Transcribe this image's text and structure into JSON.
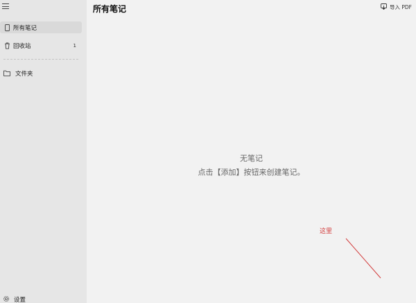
{
  "sidebar": {
    "menu_icon": "hamburger-menu-icon",
    "items": [
      {
        "label": "所有笔记",
        "icon": "note-icon",
        "selected": true
      },
      {
        "label": "回收站",
        "icon": "trash-icon",
        "count": "1"
      },
      {
        "label": "文件夹",
        "icon": "folder-icon"
      }
    ],
    "settings": {
      "label": "设置",
      "icon": "gear-icon"
    }
  },
  "header": {
    "title": "所有笔记",
    "import_pdf": {
      "label": "导入 PDF",
      "icon": "import-pdf-icon"
    }
  },
  "empty_state": {
    "title": "无笔记",
    "description": "点击【添加】按钮来创建笔记。"
  },
  "annotation": {
    "text": "这里",
    "color": "#d23b3b"
  },
  "colors": {
    "sidebar_bg": "#e6e6e6",
    "main_bg": "#f2f2f2",
    "selected_bg": "#d9d9d9"
  }
}
